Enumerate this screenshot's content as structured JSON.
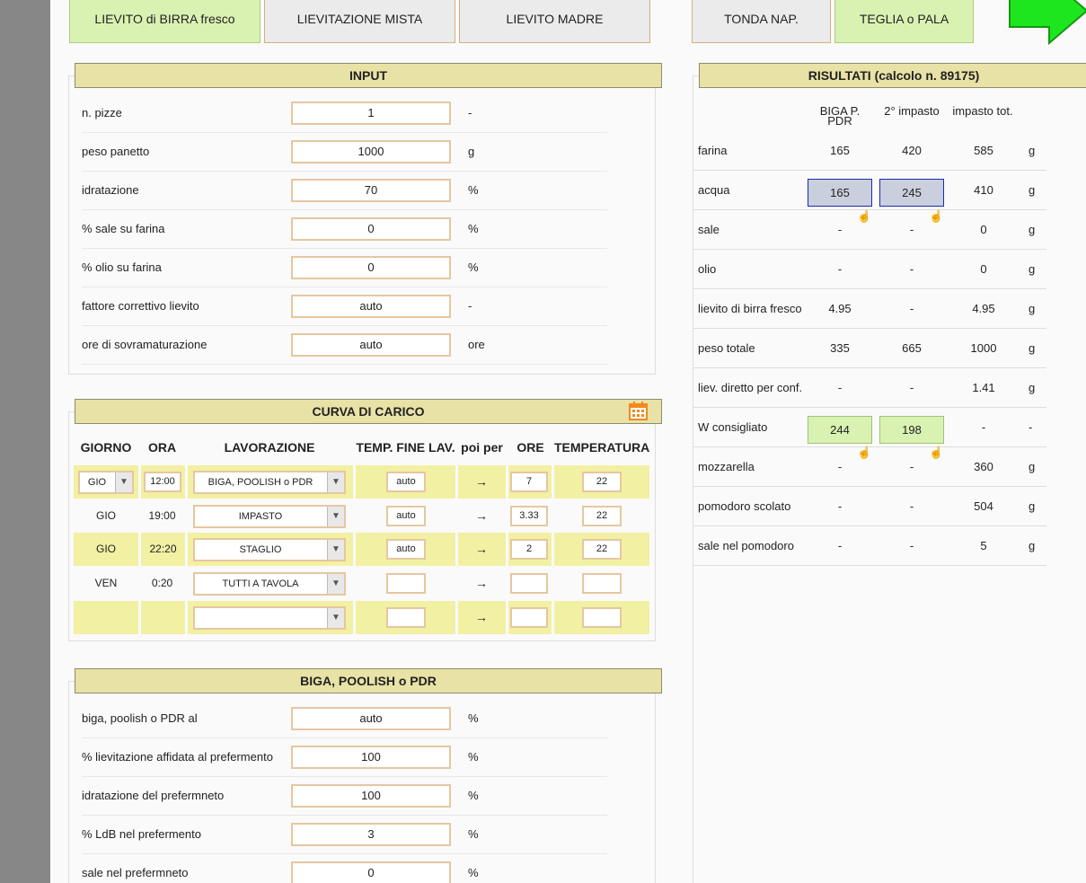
{
  "top_tabs": [
    {
      "label": "LIEVITO di BIRRA fresco",
      "active": true
    },
    {
      "label": "LIEVITAZIONE MISTA",
      "active": false
    },
    {
      "label": "LIEVITO MADRE",
      "active": false
    },
    {
      "label": "TONDA NAP.",
      "active": false
    },
    {
      "label": "TEGLIA o PALA",
      "active": true
    }
  ],
  "input": {
    "title": "INPUT",
    "rows": [
      {
        "label": "n. pizze",
        "value": "1",
        "unit": "-"
      },
      {
        "label": "peso panetto",
        "value": "1000",
        "unit": "g"
      },
      {
        "label": "idratazione",
        "value": "70",
        "unit": "%"
      },
      {
        "label": "% sale su farina",
        "value": "0",
        "unit": "%"
      },
      {
        "label": "% olio su farina",
        "value": "0",
        "unit": "%"
      },
      {
        "label": "fattore correttivo lievito",
        "value": "auto",
        "unit": "-"
      },
      {
        "label": "ore di sovramaturazione",
        "value": "auto",
        "unit": "ore"
      }
    ]
  },
  "curva": {
    "title": "CURVA DI CARICO",
    "headers": {
      "giorno": "GIORNO",
      "ora": "ORA",
      "lavorazione": "LAVORAZIONE",
      "temp_fine": "TEMP. FINE LAV.",
      "poi_per": "poi per",
      "ore": "ORE",
      "temperatura": "TEMPERATURA"
    },
    "rows": [
      {
        "giorno": "GIO",
        "ora": "12:00",
        "lavorazione": "BIGA, POOLISH o PDR",
        "temp_fine": "auto",
        "arrow": "→",
        "ore": "7",
        "temperatura": "22"
      },
      {
        "giorno": "GIO",
        "ora": "19:00",
        "lavorazione": "IMPASTO",
        "temp_fine": "auto",
        "arrow": "→",
        "ore": "3.33",
        "temperatura": "22"
      },
      {
        "giorno": "GIO",
        "ora": "22:20",
        "lavorazione": "STAGLIO",
        "temp_fine": "auto",
        "arrow": "→",
        "ore": "2",
        "temperatura": "22"
      },
      {
        "giorno": "VEN",
        "ora": "0:20",
        "lavorazione": "TUTTI A TAVOLA",
        "temp_fine": "",
        "arrow": "→",
        "ore": "",
        "temperatura": ""
      },
      {
        "giorno": "",
        "ora": "",
        "lavorazione": "",
        "temp_fine": "",
        "arrow": "→",
        "ore": "",
        "temperatura": ""
      }
    ]
  },
  "biga": {
    "title": "BIGA, POOLISH o PDR",
    "rows": [
      {
        "label": "biga, poolish o PDR al",
        "value": "auto",
        "unit": "%"
      },
      {
        "label": "% lievitazione affidata al prefermento",
        "value": "100",
        "unit": "%"
      },
      {
        "label": "idratazione del prefermneto",
        "value": "100",
        "unit": "%"
      },
      {
        "label": "% LdB nel prefermento",
        "value": "3",
        "unit": "%"
      },
      {
        "label": "sale nel prefermneto",
        "value": "0",
        "unit": "%"
      }
    ]
  },
  "results": {
    "title": "RISULTATI (calcolo n. 89175)",
    "col_headers": [
      "BIGA P. PDR",
      "2° impasto",
      "impasto tot."
    ],
    "rows": [
      {
        "label": "farina",
        "biga": "165",
        "impasto2": "420",
        "tot": "585",
        "unit": "g"
      },
      {
        "label": "acqua",
        "biga": "165",
        "impasto2": "245",
        "tot": "410",
        "unit": "g"
      },
      {
        "label": "sale",
        "biga": "-",
        "impasto2": "-",
        "tot": "0",
        "unit": "g"
      },
      {
        "label": "olio",
        "biga": "-",
        "impasto2": "-",
        "tot": "0",
        "unit": "g"
      },
      {
        "label": "lievito di birra fresco",
        "biga": "4.95",
        "impasto2": "-",
        "tot": "4.95",
        "unit": "g"
      },
      {
        "label": "peso totale",
        "biga": "335",
        "impasto2": "665",
        "tot": "1000",
        "unit": "g"
      },
      {
        "label": "liev. diretto per conf.",
        "biga": "-",
        "impasto2": "-",
        "tot": "1.41",
        "unit": "g"
      },
      {
        "label": "W consigliato",
        "biga": "244",
        "impasto2": "198",
        "tot": "-",
        "unit": "-"
      },
      {
        "label": "mozzarella",
        "biga": "-",
        "impasto2": "-",
        "tot": "360",
        "unit": "g"
      },
      {
        "label": "pomodoro scolato",
        "biga": "-",
        "impasto2": "-",
        "tot": "504",
        "unit": "g"
      },
      {
        "label": "sale nel pomodoro",
        "biga": "-",
        "impasto2": "-",
        "tot": "5",
        "unit": "g"
      }
    ]
  },
  "icons": {
    "calendar": "calendar-icon",
    "next": "next-arrow-icon",
    "hand": "hand-pointer-icon"
  },
  "colors": {
    "title_bar": "#e8e2a6",
    "active_tab": "#d9f2b2",
    "highlight_row": "#f2f0a3",
    "input_border": "#e5c7a0"
  }
}
